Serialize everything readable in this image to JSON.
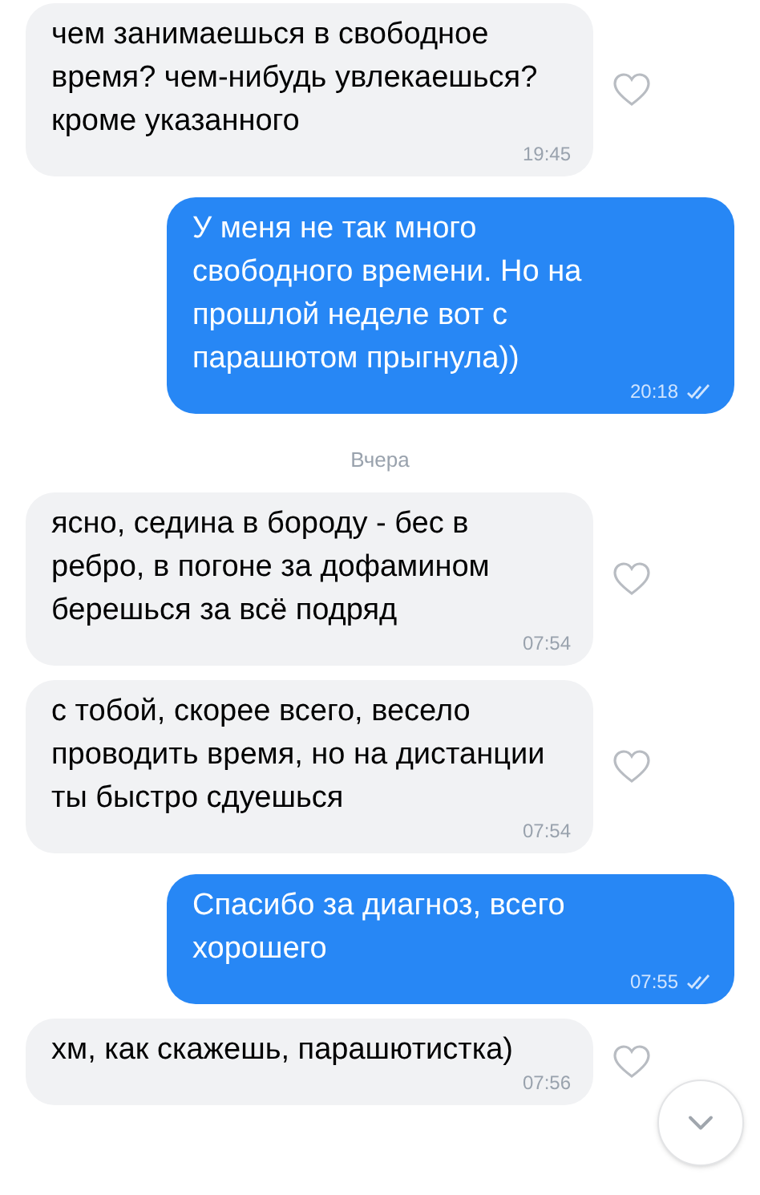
{
  "messages": [
    {
      "kind": "incoming",
      "text": "чем занимаешься в свободное время? чем-нибудь увлекаешься? кроме указанного",
      "time": "19:45",
      "liked": false
    },
    {
      "kind": "outgoing",
      "text": "У меня не так много свободного времени. Но на прошлой неделе вот с парашютом прыгнула))",
      "time": "20:18",
      "read": true
    },
    {
      "kind": "date",
      "text": "Вчера"
    },
    {
      "kind": "incoming",
      "text": "ясно, седина в бороду - бес в ребро, в погоне за дофамином берешься за всё подряд",
      "time": "07:54",
      "liked": false
    },
    {
      "kind": "incoming",
      "text": "с тобой, скорее всего, весело проводить время, но на дистанции ты быстро сдуешься",
      "time": "07:54",
      "liked": false
    },
    {
      "kind": "outgoing",
      "text": "Спасибо за диагноз, всего хорошего",
      "time": "07:55",
      "read": true
    },
    {
      "kind": "incoming",
      "text": "хм, как скажешь, парашютистка)",
      "time": "07:56",
      "liked": false
    }
  ]
}
